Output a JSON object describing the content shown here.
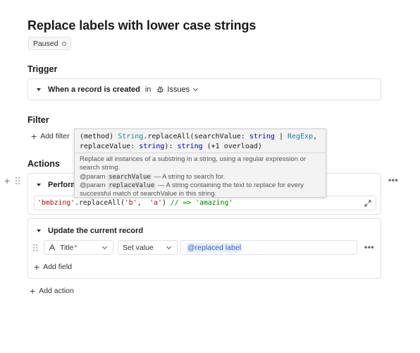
{
  "page": {
    "title": "Replace labels with lower case strings",
    "status": "Paused"
  },
  "trigger": {
    "heading": "Trigger",
    "when_text": "When a record is created",
    "in_text": "in",
    "table": "Issues",
    "table_icon": "bug-icon"
  },
  "filter": {
    "heading": "Filter",
    "add_label": "Add filter"
  },
  "tooltip": {
    "sig_prefix": "(method) ",
    "sig_owner": "String",
    "sig_method": ".replaceAll(searchValue: ",
    "sig_t1": "string",
    "sig_pipe": " | ",
    "sig_t2": "RegExp",
    "sig_comma": ",",
    "sig_line2a": "replaceValue: ",
    "sig_t3": "string",
    "sig_line2b": "): ",
    "sig_t4": "string",
    "sig_overload": " (+1 overload)",
    "desc": "Replace all instances of a substring in a string, using a regular expression or search string.",
    "param1_tag": "@param",
    "param1_name": "searchValue",
    "param1_desc": " — A string to search for.",
    "param2_tag": "@param",
    "param2_name": "replaceValue",
    "param2_desc": " — A string containing the text to replace for every successful match of searchValue in this string."
  },
  "actions": {
    "heading": "Actions",
    "perform_label": "Perform",
    "code": {
      "s1": "'bmbzing'",
      "f": ".replaceAll(",
      "s2": "'b'",
      "sep": ",  ",
      "s3": "'a'",
      "close": ") ",
      "comment": "// => 'amazing'"
    },
    "update_label": "Update the current record",
    "field_name": "Title",
    "required_mark": "*",
    "op_value": "Set value",
    "value_token": "@replaced label",
    "add_field_label": "Add field",
    "add_action_label": "Add action"
  },
  "colors": {
    "keyword": "#0000cc",
    "type": "#267f99",
    "string": "#a31515",
    "comment": "#008000",
    "token_bg": "#e8eefb",
    "token_fg": "#2f5fc4"
  }
}
